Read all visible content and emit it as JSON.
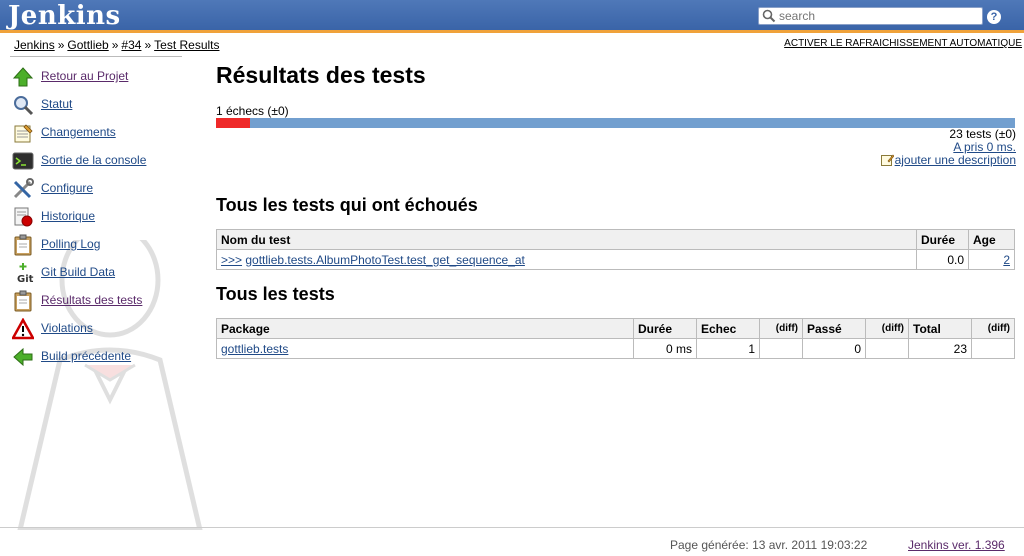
{
  "header": {
    "logo": "Jenkins",
    "search_placeholder": "search",
    "help_label": "?"
  },
  "breadcrumb": {
    "items": [
      "Jenkins",
      "Gottlieb",
      "#34",
      "Test Results"
    ],
    "separator": "»"
  },
  "auto_refresh_label": "ACTIVER LE RAFRAICHISSEMENT AUTOMATIQUE",
  "sidebar": {
    "items": [
      {
        "label": "Retour au Projet",
        "icon": "up-arrow-icon"
      },
      {
        "label": "Statut",
        "icon": "magnifier-icon"
      },
      {
        "label": "Changements",
        "icon": "notepad-icon"
      },
      {
        "label": "Sortie de la console",
        "icon": "terminal-icon"
      },
      {
        "label": "Configure",
        "icon": "tools-icon"
      },
      {
        "label": "Historique",
        "icon": "history-icon"
      },
      {
        "label": "Polling Log",
        "icon": "clipboard-icon"
      },
      {
        "label": "Git Build Data",
        "icon": "git-icon"
      },
      {
        "label": "Résultats des tests",
        "icon": "clipboard-icon"
      },
      {
        "label": "Violations",
        "icon": "warning-icon"
      },
      {
        "label": "Build précédente",
        "icon": "left-arrow-icon"
      }
    ]
  },
  "main": {
    "title": "Résultats des tests",
    "fail_count": "1 échecs (±0)",
    "fail_fraction": 0.043,
    "colors": {
      "fail": "#ef2929",
      "pass": "#729fcf"
    },
    "total_tests": "23 tests (±0)",
    "duration_link": "A pris 0 ms.",
    "add_description": "ajouter une description",
    "failed_heading": "Tous les tests qui ont échoués",
    "failed_table": {
      "headers": [
        "Nom du test",
        "Durée",
        "Age"
      ],
      "rows": [
        {
          "prefix": ">>>",
          "name": "gottlieb.tests.AlbumPhotoTest.test_get_sequence_at",
          "duration": "0.0",
          "age": "2"
        }
      ]
    },
    "all_heading": "Tous les tests",
    "all_table": {
      "headers": [
        "Package",
        "Durée",
        "Echec",
        "(diff)",
        "Passé",
        "(diff)",
        "Total",
        "(diff)"
      ],
      "rows": [
        {
          "package": "gottlieb.tests",
          "duration": "0 ms",
          "fail": "1",
          "fail_diff": "",
          "pass": "0",
          "pass_diff": "",
          "total": "23",
          "total_diff": ""
        }
      ]
    }
  },
  "footer": {
    "generated": "Page générée: 13 avr. 2011 19:03:22",
    "version": "Jenkins ver. 1.396"
  }
}
